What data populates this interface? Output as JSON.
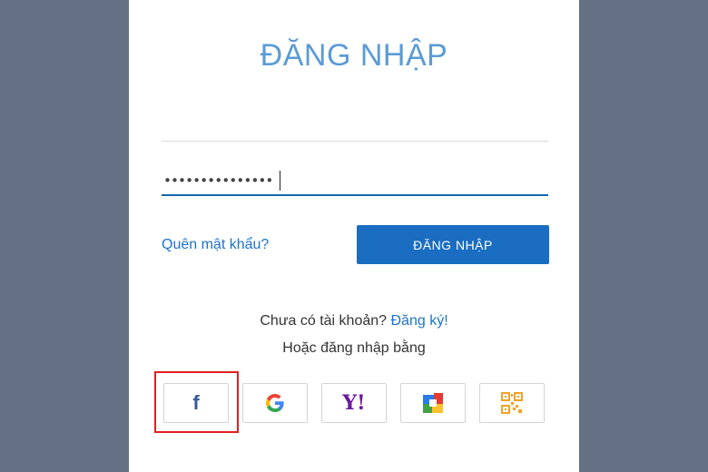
{
  "login": {
    "title": "ĐĂNG NHẬP",
    "username": {
      "value": "",
      "placeholder": ""
    },
    "password": {
      "masked_value": "•••••••••••••••"
    },
    "forgot_label": "Quên mật khẩu?",
    "submit_label": "ĐĂNG NHẬP",
    "no_account_text": "Chưa có tài khoản?",
    "signup_label": "Đăng ký!",
    "alt_login_text": "Hoặc đăng nhập bằng"
  },
  "social_logins": [
    {
      "name": "facebook",
      "icon": "facebook-icon",
      "glyph": "f",
      "color": "#3b5998",
      "highlighted": true
    },
    {
      "name": "google",
      "icon": "google-icon",
      "glyph": "G"
    },
    {
      "name": "yahoo",
      "icon": "yahoo-icon",
      "glyph": "Y!",
      "color": "#6a1b9a"
    },
    {
      "name": "colored-square",
      "icon": "multicolor-square-icon"
    },
    {
      "name": "qr-code",
      "icon": "qr-code-icon",
      "color": "#f2a227"
    }
  ],
  "colors": {
    "background": "#647083",
    "card": "#ffffff",
    "title": "#5b9bd5",
    "button": "#1a6dc1",
    "link": "#1a73c9",
    "highlight_border": "#e02020"
  }
}
